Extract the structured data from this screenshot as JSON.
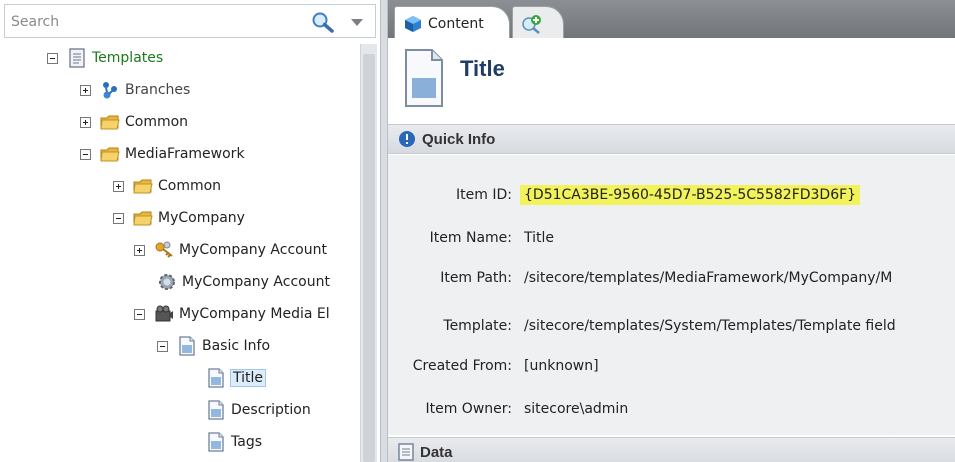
{
  "search": {
    "placeholder": "Search"
  },
  "tree": {
    "items": [
      {
        "label": "Templates",
        "toggle": "minus",
        "icon": "template-icon"
      },
      {
        "label": "Branches",
        "toggle": "plus",
        "icon": "branches-icon"
      },
      {
        "label": "Common",
        "toggle": "plus",
        "icon": "folder-icon"
      },
      {
        "label": "MediaFramework",
        "toggle": "minus",
        "icon": "folder-icon"
      },
      {
        "label": "Common",
        "toggle": "plus",
        "icon": "folder-icon"
      },
      {
        "label": "MyCompany",
        "toggle": "minus",
        "icon": "folder-icon"
      },
      {
        "label": "MyCompany Account",
        "toggle": "plus",
        "icon": "keys-icon"
      },
      {
        "label": "MyCompany Account",
        "toggle": "none",
        "icon": "gear-icon"
      },
      {
        "label": "MyCompany Media El",
        "toggle": "minus",
        "icon": "media-icon"
      },
      {
        "label": "Basic Info",
        "toggle": "minus",
        "icon": "document-icon"
      },
      {
        "label": "Title",
        "toggle": "none",
        "icon": "document-icon",
        "selected": true
      },
      {
        "label": "Description",
        "toggle": "none",
        "icon": "document-icon"
      },
      {
        "label": "Tags",
        "toggle": "none",
        "icon": "document-icon"
      }
    ]
  },
  "tabs": {
    "content_label": "Content",
    "add_tab_icon": "add-tab-icon"
  },
  "item": {
    "title": "Title"
  },
  "quick_info": {
    "header": "Quick Info",
    "rows": [
      {
        "label": "Item ID:",
        "value": "{D51CA3BE-9560-45D7-B525-5C5582FD3D6F}"
      },
      {
        "label": "Item Name:",
        "value": "Title"
      },
      {
        "label": "Item Path:",
        "value": "/sitecore/templates/MediaFramework/MyCompany/M"
      },
      {
        "label": "Template:",
        "value": "/sitecore/templates/System/Templates/Template field"
      },
      {
        "label": "Created From:",
        "value": "[unknown]"
      },
      {
        "label": "Item Owner:",
        "value": "sitecore\\admin"
      }
    ]
  },
  "data_section": {
    "header": "Data"
  },
  "colors": {
    "highlight": "#f2f25a",
    "selected_bg": "#dcecfb",
    "templates_label": "#1b7a1b",
    "title_color": "#1f3d66"
  }
}
